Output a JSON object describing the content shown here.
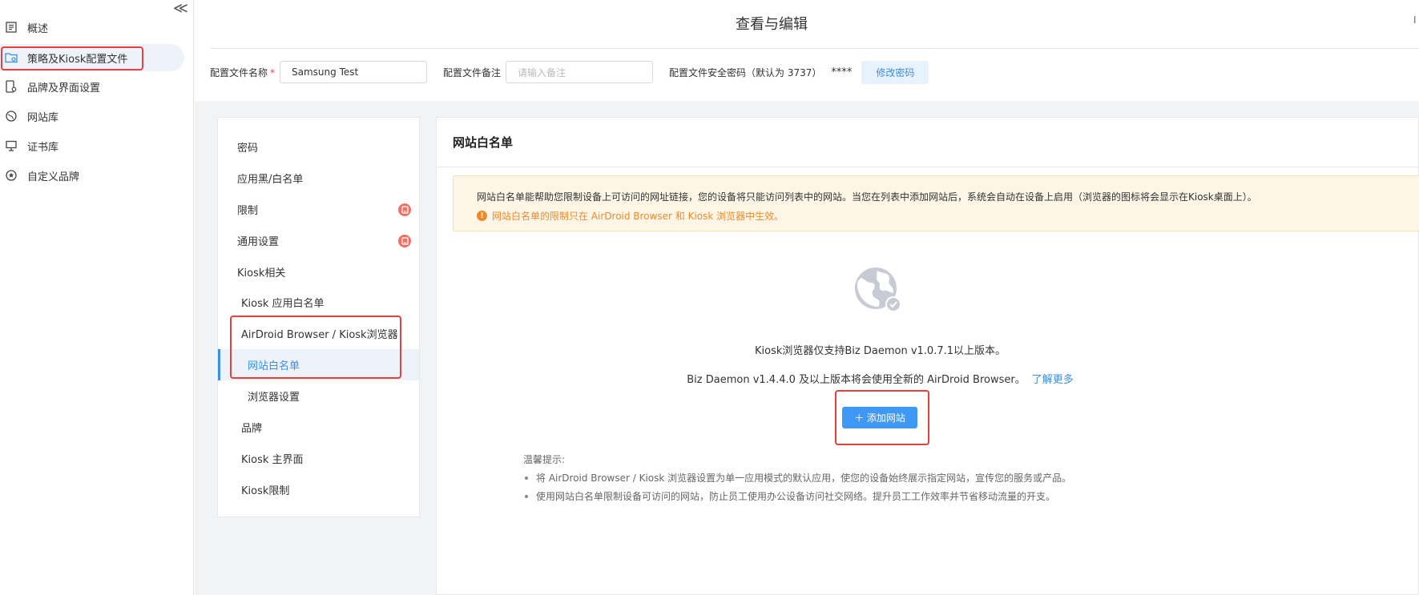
{
  "sidebar": {
    "collapse_icon": "≪",
    "items": [
      {
        "label": "概述",
        "icon": "list-icon"
      },
      {
        "label": "策略及Kiosk配置文件",
        "icon": "folder-settings-icon"
      },
      {
        "label": "品牌及界面设置",
        "icon": "device-settings-icon"
      },
      {
        "label": "网站库",
        "icon": "globe-icon"
      },
      {
        "label": "证书库",
        "icon": "certificate-icon"
      },
      {
        "label": "自定义品牌",
        "icon": "star-icon"
      }
    ]
  },
  "header": {
    "title": "查看与编辑",
    "right_mark": "I"
  },
  "form": {
    "name_label": "配置文件名称",
    "required_mark": "*",
    "name_value": "Samsung Test",
    "note_label": "配置文件备注",
    "note_placeholder": "请输入备注",
    "password_label": "配置文件安全密码（默认为 3737）",
    "password_mask": "****",
    "change_password_button": "修改密码"
  },
  "menu": {
    "items": [
      {
        "label": "密码",
        "badge": false
      },
      {
        "label": "应用黑/白名单",
        "badge": false
      },
      {
        "label": "限制",
        "badge": true
      },
      {
        "label": "通用设置",
        "badge": true
      },
      {
        "label": "Kiosk相关",
        "badge": false
      },
      {
        "label": "Kiosk 应用白名单",
        "badge": false
      },
      {
        "label": "AirDroid Browser / Kiosk浏览器",
        "badge": false
      },
      {
        "label": "网站白名单",
        "badge": false,
        "active": true
      },
      {
        "label": "浏览器设置",
        "badge": false
      },
      {
        "label": "品牌",
        "badge": false
      },
      {
        "label": "Kiosk 主界面",
        "badge": false
      },
      {
        "label": "Kiosk限制",
        "badge": false
      }
    ]
  },
  "main": {
    "title": "网站白名单",
    "notice_text": "网站白名单能帮助您限制设备上可访问的网址链接，您的设备将只能访问列表中的网站。当您在列表中添加网站后，系统会自动在设备上启用（浏览器的图标将会显示在Kiosk桌面上）。",
    "notice_warning": "网站白名单的限制只在 AirDroid Browser 和 Kiosk 浏览器中生效。",
    "support_line": "Kiosk浏览器仅支持Biz Daemon v1.0.7.1以上版本。",
    "browser_line": "Biz Daemon v1.4.4.0 及以上版本将会使用全新的 AirDroid Browser。",
    "learn_more": "了解更多",
    "add_button": "＋ 添加网站",
    "tips_title": "温馨提示:",
    "tips": [
      "将 AirDroid Browser / Kiosk 浏览器设置为单一应用模式的默认应用，使您的设备始终展示指定网站，宣传您的服务或产品。",
      "使用网站白名单限制设备可访问的网站，防止员工使用办公设备访问社交网络。提升员工工作效率并节省移动流量的开支。"
    ]
  },
  "colors": {
    "accent": "#3a8ee6",
    "highlight_box": "#e8413b",
    "warning": "#ee8a2c",
    "notice_bg": "#fdf6e6"
  }
}
